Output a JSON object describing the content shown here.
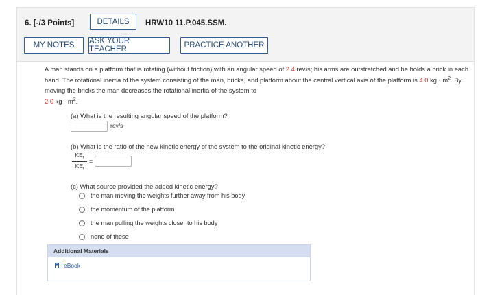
{
  "header": {
    "question_number": "6.",
    "points": "[-/3 Points]",
    "details_label": "DETAILS",
    "problem_code": "HRW10 11.P.045.SSM.",
    "my_notes_label": "MY NOTES",
    "ask_teacher_label": "ASK YOUR TEACHER",
    "practice_label": "PRACTICE ANOTHER"
  },
  "problem": {
    "text_1": "A man stands on a platform that is rotating (without friction) with an angular speed of ",
    "angular_speed": "2.4",
    "text_2": " rev/s; his arms are outstretched and he holds a brick in each hand. The rotational inertia of the system consisting of the man, bricks, and platform about the central vertical axis of the platform is ",
    "inertia_initial": "4.0",
    "text_3": " kg · m",
    "text_4": ". By moving the bricks the man decreases the rotational inertia of the system to",
    "inertia_final": "2.0",
    "text_5": " kg · m",
    "text_6": ".",
    "exp": "2"
  },
  "part_a": {
    "question": "(a) What is the resulting angular speed of the platform?",
    "answer_value": "",
    "unit": "rev/s"
  },
  "part_b": {
    "question": "(b) What is the ratio of the new kinetic energy of the system to the original kinetic energy?",
    "numerator": "KEf",
    "denominator": "KEi",
    "equals": "=",
    "answer_value": ""
  },
  "part_c": {
    "question": "(c) What source provided the added kinetic energy?",
    "options": [
      "the man moving the weights further away from his body",
      "the momentum of the platform",
      "the man pulling the weights closer to his body",
      "none of these"
    ]
  },
  "additional": {
    "heading": "Additional Materials",
    "ebook_label": "eBook",
    "ebook_icon": "book-icon"
  }
}
